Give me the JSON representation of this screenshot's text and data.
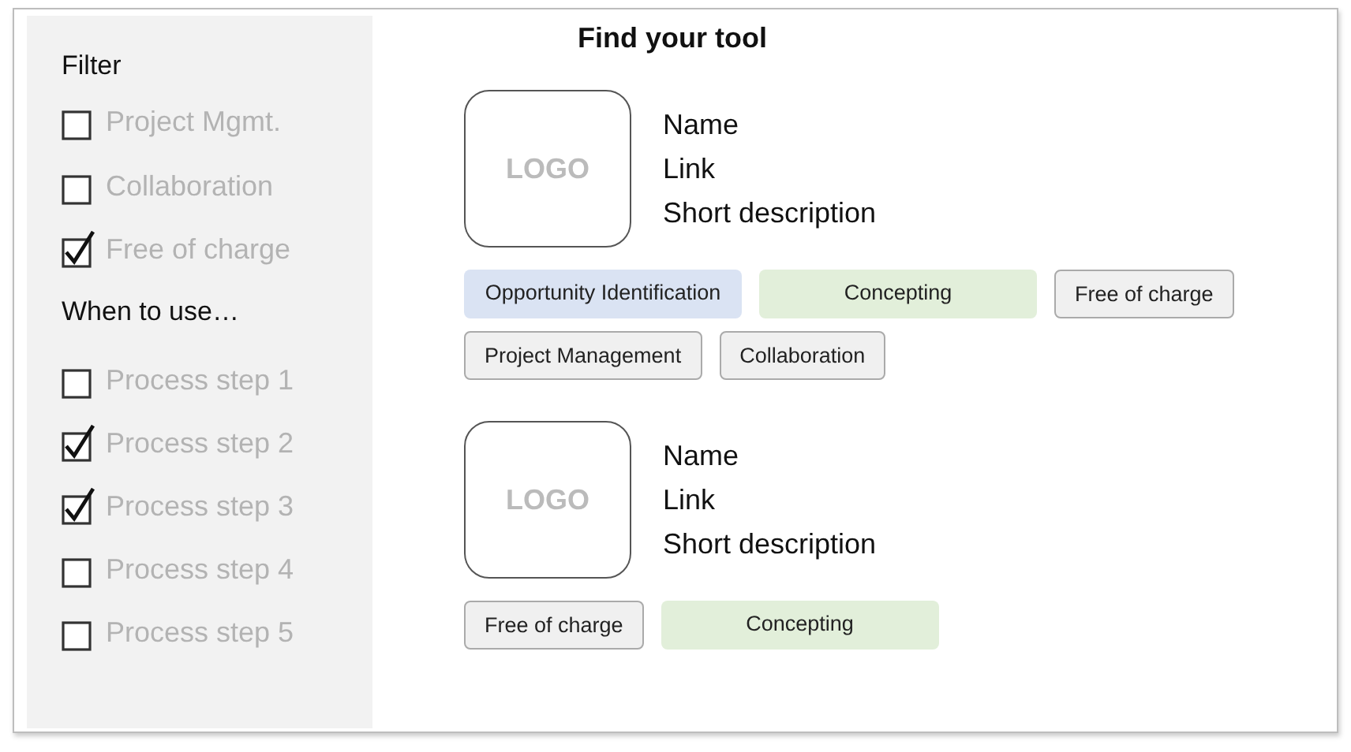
{
  "sidebar": {
    "sections": [
      {
        "title": "Filter",
        "items": [
          {
            "label": "Project Mgmt.",
            "checked": false
          },
          {
            "label": "Collaboration",
            "checked": false
          },
          {
            "label": "Free of charge",
            "checked": true
          }
        ]
      },
      {
        "title": "When to use…",
        "items": [
          {
            "label": "Process step 1",
            "checked": false
          },
          {
            "label": "Process step 2",
            "checked": true
          },
          {
            "label": "Process step 3",
            "checked": true
          },
          {
            "label": "Process step 4",
            "checked": false
          },
          {
            "label": "Process step 5",
            "checked": false
          }
        ]
      }
    ]
  },
  "title": "Find your tool",
  "tools": [
    {
      "logo": "LOGO",
      "name": "Name",
      "link": "Link",
      "description": "Short description",
      "tags": [
        {
          "label": "Opportunity Identification",
          "kind": "phase",
          "color": "#dae3f3"
        },
        {
          "label": "Concepting",
          "kind": "phase",
          "color": "#e2efda"
        },
        {
          "label": "Free of charge",
          "kind": "attribute"
        },
        {
          "label": "Project Management",
          "kind": "attribute"
        },
        {
          "label": "Collaboration",
          "kind": "attribute"
        }
      ]
    },
    {
      "logo": "LOGO",
      "name": "Name",
      "link": "Link",
      "description": "Short description",
      "tags": [
        {
          "label": "Free of charge",
          "kind": "attribute"
        },
        {
          "label": "Concepting",
          "kind": "phase",
          "color": "#e2efda"
        }
      ]
    }
  ]
}
